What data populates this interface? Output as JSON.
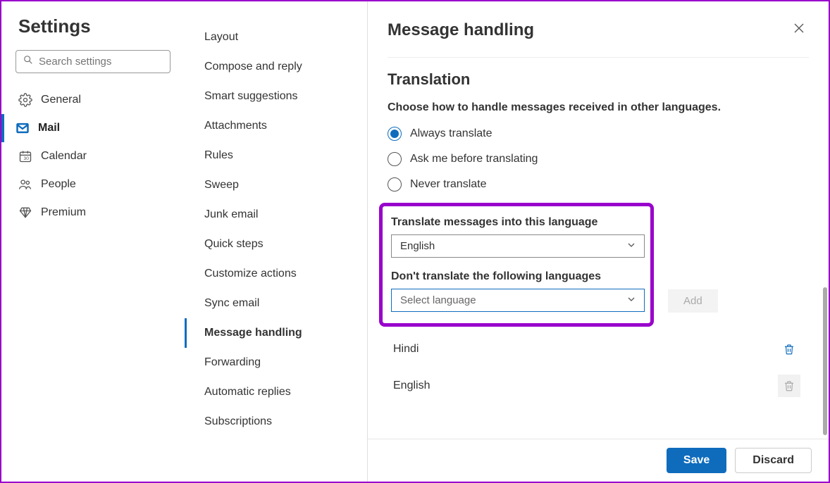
{
  "sidebar": {
    "title": "Settings",
    "search_placeholder": "Search settings",
    "items": [
      {
        "id": "general",
        "label": "General"
      },
      {
        "id": "mail",
        "label": "Mail",
        "active": true
      },
      {
        "id": "calendar",
        "label": "Calendar"
      },
      {
        "id": "people",
        "label": "People"
      },
      {
        "id": "premium",
        "label": "Premium"
      }
    ]
  },
  "mid_nav": {
    "items": [
      "Layout",
      "Compose and reply",
      "Smart suggestions",
      "Attachments",
      "Rules",
      "Sweep",
      "Junk email",
      "Quick steps",
      "Customize actions",
      "Sync email",
      "Message handling",
      "Forwarding",
      "Automatic replies",
      "Subscriptions"
    ],
    "active_index": 10
  },
  "content": {
    "header_title": "Message handling",
    "section_title": "Translation",
    "section_desc": "Choose how to handle messages received in other languages.",
    "radios": [
      {
        "label": "Always translate",
        "checked": true
      },
      {
        "label": "Ask me before translating",
        "checked": false
      },
      {
        "label": "Never translate",
        "checked": false
      }
    ],
    "translate_into_label": "Translate messages into this language",
    "translate_into_value": "English",
    "dont_translate_label": "Don't translate the following languages",
    "dont_translate_placeholder": "Select language",
    "add_button": "Add",
    "excluded_languages": [
      {
        "name": "Hindi",
        "deletable": true
      },
      {
        "name": "English",
        "deletable": false
      }
    ]
  },
  "footer": {
    "save": "Save",
    "discard": "Discard"
  }
}
